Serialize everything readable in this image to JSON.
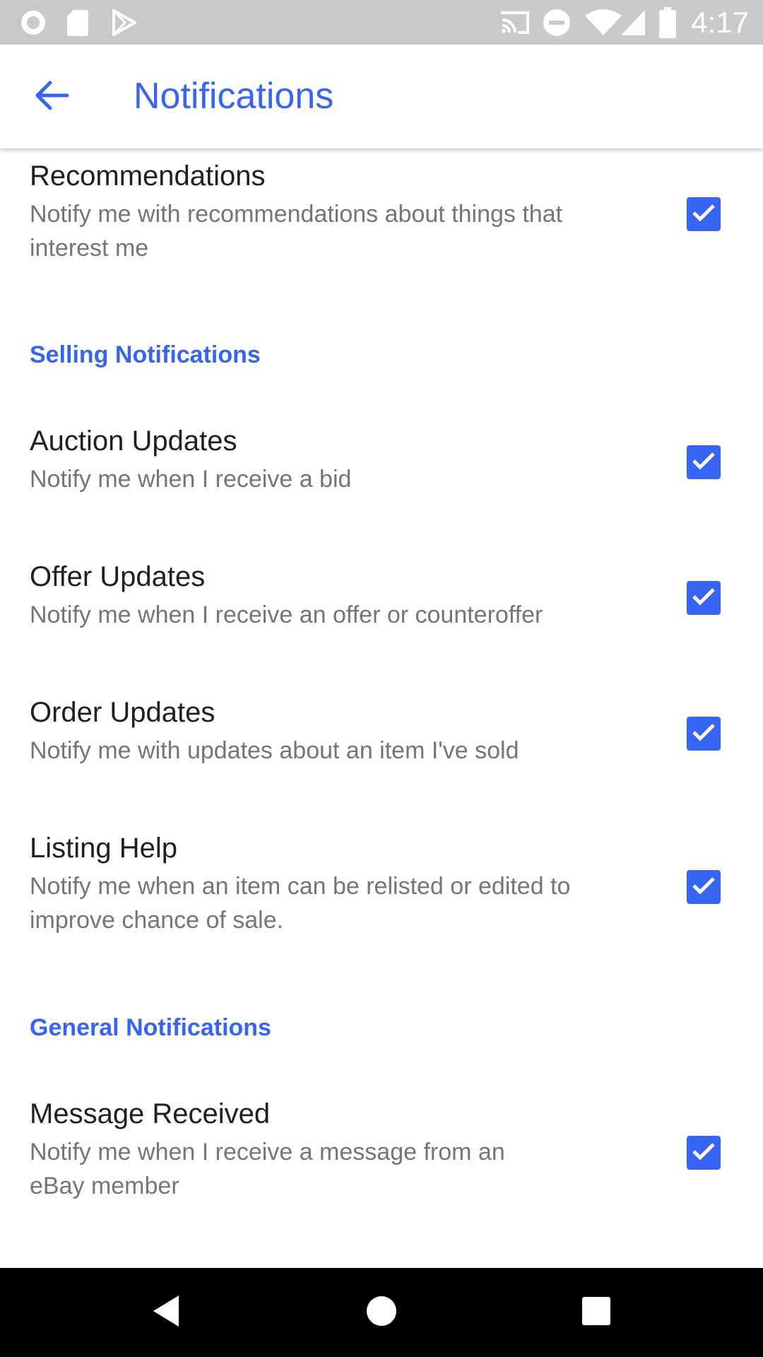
{
  "status_bar": {
    "time": "4:17",
    "left_icons": [
      "record-icon",
      "sd-card-icon",
      "play-store-icon"
    ],
    "right_icons": [
      "cast-icon",
      "do-not-disturb-icon",
      "wifi-icon",
      "signal-icon",
      "battery-icon"
    ]
  },
  "app_bar": {
    "back_icon": "arrow-back-icon",
    "title": "Notifications",
    "accent_color": "#3665f3"
  },
  "items": [
    {
      "title": "Recommendations",
      "description": "Notify me with recommendations about things that interest me",
      "checked": true
    },
    {
      "section": "Selling Notifications"
    },
    {
      "title": "Auction Updates",
      "description": "Notify me when I receive a bid",
      "checked": true
    },
    {
      "title": "Offer Updates",
      "description": "Notify me when I receive an offer or counteroffer",
      "checked": true
    },
    {
      "title": "Order Updates",
      "description": "Notify me with updates about an item I've sold",
      "checked": true
    },
    {
      "title": "Listing Help",
      "description": "Notify me when an item can be relisted or edited to improve chance of sale.",
      "checked": true
    },
    {
      "section": "General Notifications"
    },
    {
      "title": "Message Received",
      "description": "Notify me when I receive a message from an eBay member",
      "checked": true
    }
  ],
  "nav_bar": {
    "buttons": [
      "back-triangle-icon",
      "home-circle-icon",
      "recents-square-icon"
    ]
  }
}
